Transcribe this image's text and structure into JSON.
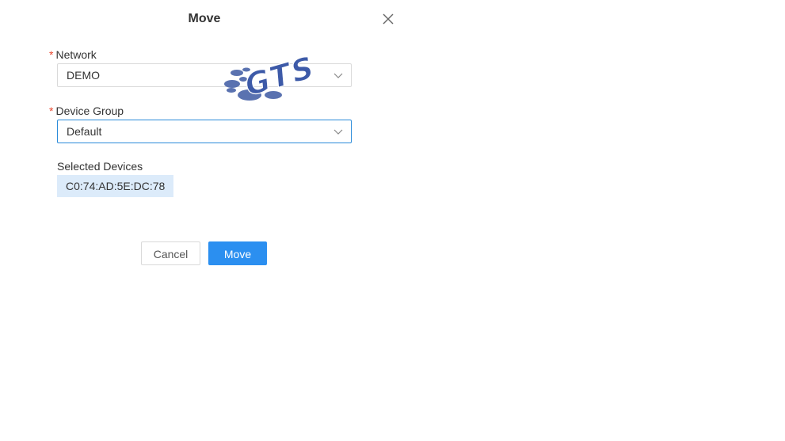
{
  "dialog": {
    "title": "Move",
    "close_icon": "close-icon"
  },
  "form": {
    "required_marker": "*",
    "network": {
      "label": "Network",
      "value": "DEMO"
    },
    "device_group": {
      "label": "Device Group",
      "value": "Default"
    },
    "selected_devices": {
      "label": "Selected Devices",
      "items": [
        "C0:74:AD:5E:DC:78"
      ]
    }
  },
  "actions": {
    "cancel_label": "Cancel",
    "confirm_label": "Move"
  },
  "watermark": {
    "text": "GTS"
  },
  "colors": {
    "primary": "#2b8ff0",
    "required": "#e8452c",
    "tag_background": "#dcebfa",
    "focus_border": "#2a8bd9",
    "watermark": "#5a72b0"
  }
}
